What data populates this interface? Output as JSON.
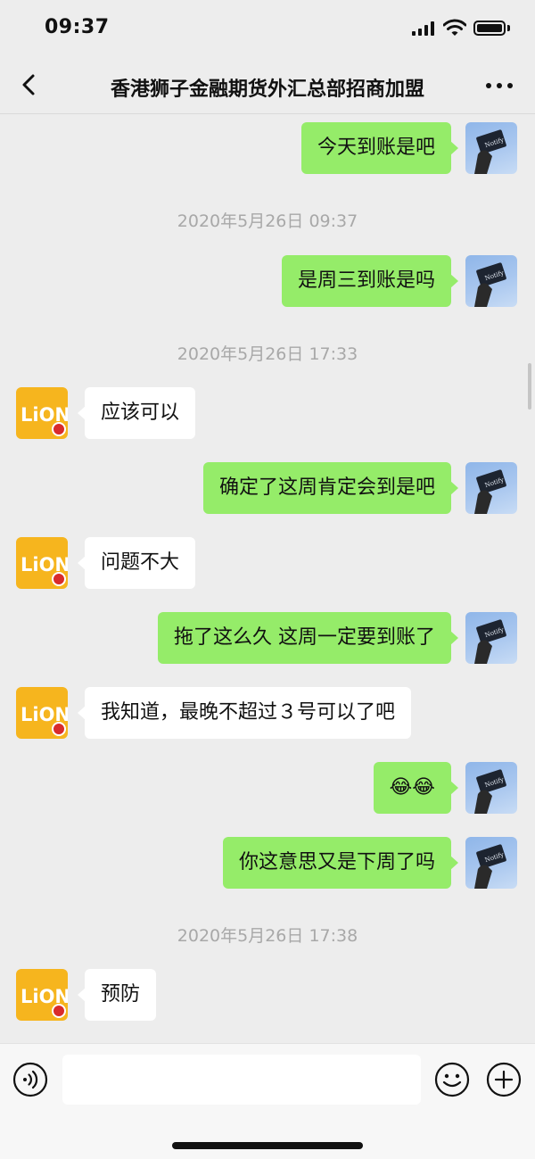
{
  "status_bar": {
    "time": "09:37"
  },
  "header": {
    "title": "香港狮子金融期货外汇总部招商加盟"
  },
  "messages": [
    {
      "text": "今天到账是吧"
    },
    {
      "timestamp": "2020年5月26日 09:37"
    },
    {
      "text": "是周三到账是吗"
    },
    {
      "timestamp": "2020年5月26日 17:33"
    },
    {
      "text": "应该可以"
    },
    {
      "text": "确定了这周肯定会到是吧"
    },
    {
      "text": "问题不大"
    },
    {
      "text": "拖了这么久   这周一定要到账了"
    },
    {
      "text": "我知道，最晚不超过３号可以了吧"
    },
    {
      "text": "😂😂"
    },
    {
      "text": "你这意思又是下周了吗"
    },
    {
      "timestamp": "2020年5月26日 17:38"
    },
    {
      "text": "预防"
    }
  ],
  "avatars": {
    "self_card_text": "Notify",
    "other_logo_text": "LiON"
  },
  "composer": {
    "placeholder": ""
  },
  "colors": {
    "bubble_self": "#95ec69",
    "bubble_other": "#ffffff",
    "background": "#ededed",
    "other_avatar": "#f6b51e"
  }
}
